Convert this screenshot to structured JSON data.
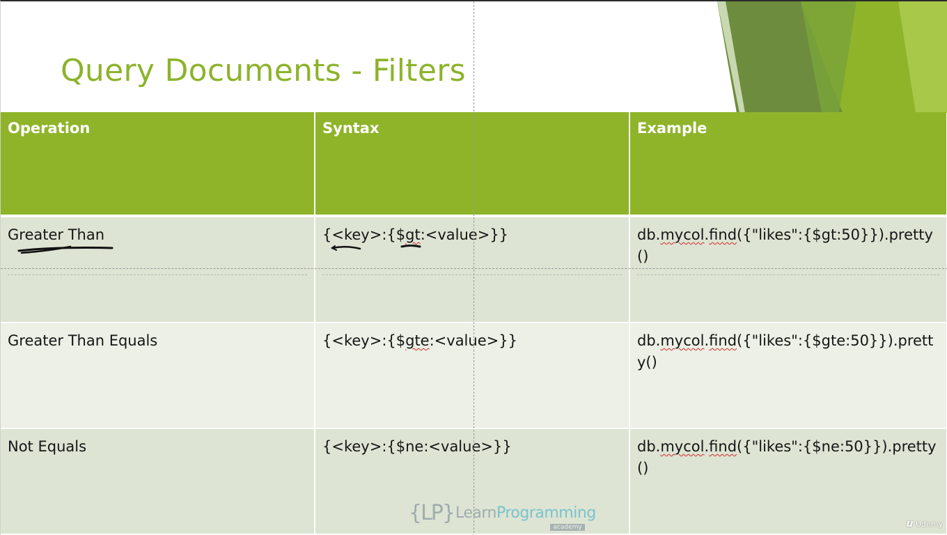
{
  "slide": {
    "title": "Query Documents - Filters"
  },
  "table": {
    "headers": [
      "Operation",
      "Syntax",
      "Example"
    ],
    "rows": [
      {
        "operation": "Greater Than",
        "syntax_pre": "{<key>:{$",
        "syntax_op": "gt",
        "syntax_post": ":<value>}}",
        "example_pre": "db.",
        "example_obj": "mycol",
        "example_dot": ".",
        "example_fn": "find",
        "example_post": "({\"likes\":{$gt:50}}).pretty()"
      },
      {
        "operation": "Greater Than Equals",
        "syntax_pre": "{<key>:{$",
        "syntax_op": "gte",
        "syntax_post": ":<value>}}",
        "example_pre": "db.",
        "example_obj": "mycol",
        "example_dot": ".",
        "example_fn": "find",
        "example_post": "({\"likes\":{$gte:50}}).pretty()"
      },
      {
        "operation": "Not Equals",
        "syntax_pre": "{<key>:{$",
        "syntax_op": "ne",
        "syntax_post": ":<value>}}",
        "example_pre": "db.",
        "example_obj": "mycol",
        "example_dot": ".",
        "example_fn": "find",
        "example_post": "({\"likes\":{$ne:50}}).pretty()"
      }
    ]
  },
  "logo": {
    "mark": "{LP}",
    "text_main": "Learn",
    "text_accent": "Programming",
    "sub": "academy"
  },
  "watermark": {
    "text": "Udemy"
  },
  "colors": {
    "accent": "#8fb42a",
    "row_dark": "#dde4d3",
    "row_light": "#ecf0e6",
    "title": "#8db32b"
  }
}
